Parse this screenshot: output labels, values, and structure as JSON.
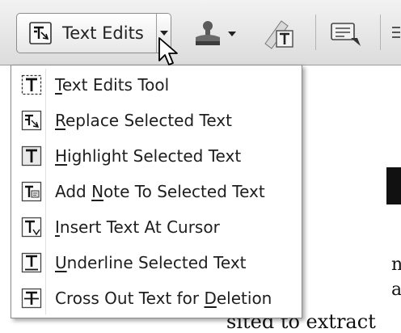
{
  "toolbar": {
    "text_edits_label": "Text Edits"
  },
  "menu": {
    "items": [
      {
        "pre": "",
        "key": "T",
        "post": "ext Edits Tool",
        "icon": "text-edits-tool-icon"
      },
      {
        "pre": "",
        "key": "R",
        "post": "eplace Selected Text",
        "icon": "replace-text-icon"
      },
      {
        "pre": "",
        "key": "H",
        "post": "ighlight Selected Text",
        "icon": "highlight-text-icon"
      },
      {
        "pre": "Add ",
        "key": "N",
        "post": "ote To Selected Text",
        "icon": "add-note-icon"
      },
      {
        "pre": "",
        "key": "I",
        "post": "nsert Text At Cursor",
        "icon": "insert-text-icon"
      },
      {
        "pre": "",
        "key": "U",
        "post": "nderline Selected Text",
        "icon": "underline-text-icon"
      },
      {
        "pre": "Cross Out Text for ",
        "key": "D",
        "post": "eletion",
        "icon": "strikethrough-text-icon"
      }
    ]
  },
  "document": {
    "line_bottom": "sited to extract"
  }
}
